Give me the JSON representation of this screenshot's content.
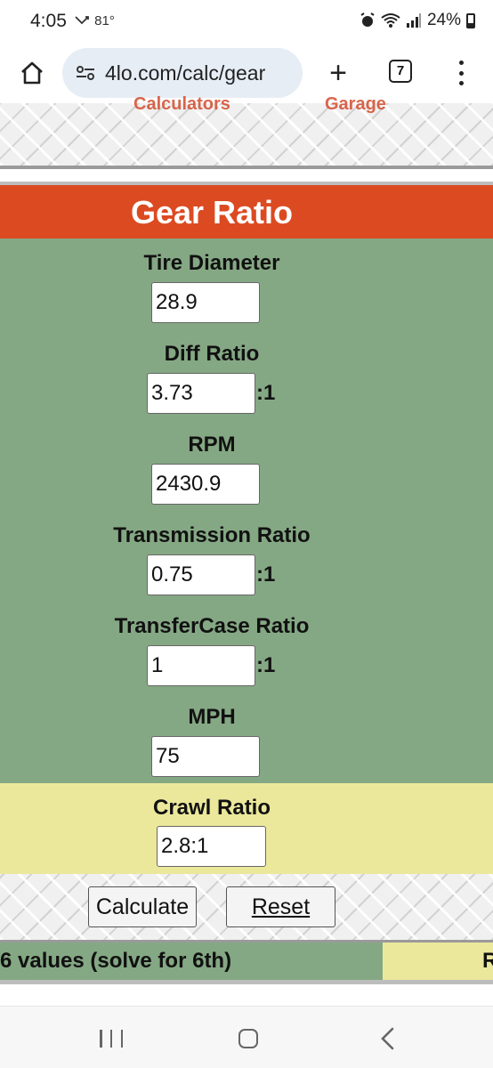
{
  "status": {
    "time": "4:05",
    "temp": "81°",
    "battery": "24%"
  },
  "browser": {
    "url": "4lo.com/calc/gear",
    "tab_count": "7"
  },
  "nav_cut": {
    "left": "Calculators",
    "right": "Garage"
  },
  "calculator": {
    "title": "Gear Ratio",
    "ratio_suffix": ":1",
    "fields": {
      "tire_diameter": {
        "label": "Tire Diameter",
        "value": "28.9"
      },
      "diff_ratio": {
        "label": "Diff Ratio",
        "value": "3.73"
      },
      "rpm": {
        "label": "RPM",
        "value": "2430.9"
      },
      "transmission_ratio": {
        "label": "Transmission Ratio",
        "value": "0.75"
      },
      "transfercase_ratio": {
        "label": "TransferCase Ratio",
        "value": "1"
      },
      "mph": {
        "label": "MPH",
        "value": "75"
      }
    },
    "crawl": {
      "label": "Crawl Ratio",
      "value": "2.8:1"
    },
    "buttons": {
      "calculate": "Calculate",
      "reset": "Reset"
    },
    "hint_green": "6 values (solve for 6th)",
    "hint_yellow": "R"
  },
  "colors": {
    "title_bar": "#dc4a22",
    "form_green": "#85a884",
    "crawl_yellow": "#ebe89c"
  }
}
